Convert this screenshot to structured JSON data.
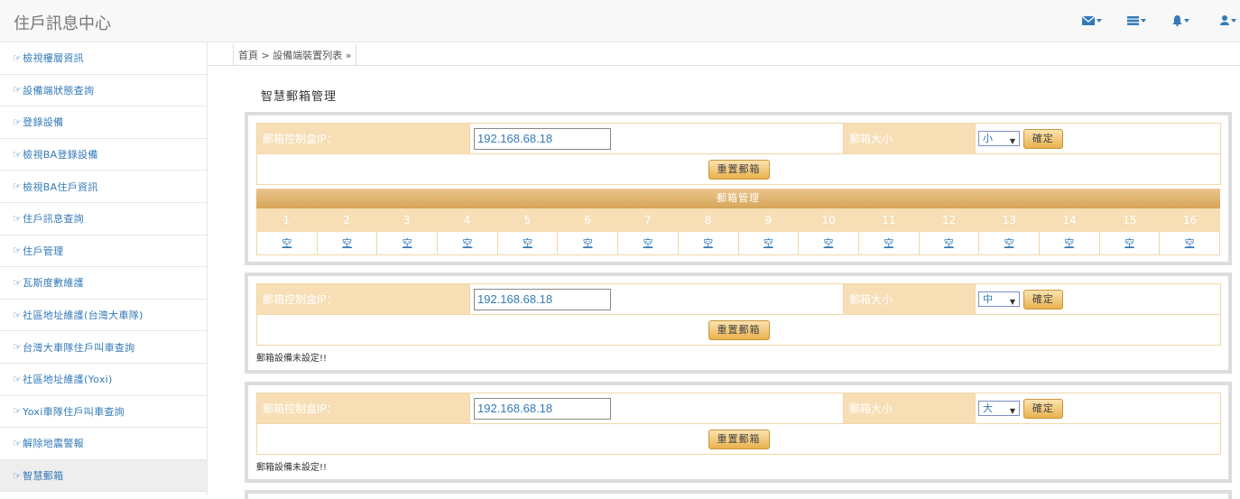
{
  "app": {
    "title": "住戶訊息中心"
  },
  "sidebar": {
    "items": [
      {
        "label": "檢視樓層資訊"
      },
      {
        "label": "設備端狀態查詢"
      },
      {
        "label": "登錄設備"
      },
      {
        "label": "檢視BA登錄設備"
      },
      {
        "label": "檢視BA住戶資訊"
      },
      {
        "label": "住戶訊息查詢"
      },
      {
        "label": "住戶管理"
      },
      {
        "label": "瓦斯度數維護"
      },
      {
        "label": "社區地址維護(台灣大車隊)"
      },
      {
        "label": "台灣大車隊住戶叫車查詢"
      },
      {
        "label": "社區地址維護(Yoxi)"
      },
      {
        "label": "Yoxi車隊住戶叫車查詢"
      },
      {
        "label": "解除地震警報"
      },
      {
        "label": "智慧郵箱"
      }
    ],
    "hand_glyph": "☞"
  },
  "breadcrumb": {
    "text": "首頁 > 設備端裝置列表 »"
  },
  "page_title": "智慧郵箱管理",
  "panels": [
    {
      "ip_label": "郵箱控制盒IP：",
      "ip_value": "192.168.68.18",
      "size_label": "郵箱大小",
      "size_value": "小",
      "confirm_label": "確定",
      "reset_label": "重置郵箱",
      "mgmt_title": "郵箱管理",
      "slot_numbers": [
        "1",
        "2",
        "3",
        "4",
        "5",
        "6",
        "7",
        "8",
        "9",
        "10",
        "11",
        "12",
        "13",
        "14",
        "15",
        "16"
      ],
      "slot_status": "空"
    },
    {
      "ip_label": "郵箱控制盒IP：",
      "ip_value": "192.168.68.18",
      "size_label": "郵箱大小",
      "size_value": "中",
      "confirm_label": "確定",
      "reset_label": "重置郵箱",
      "note": "郵箱設備未設定!!"
    },
    {
      "ip_label": "郵箱控制盒IP：",
      "ip_value": "192.168.68.18",
      "size_label": "郵箱大小",
      "size_value": "大",
      "confirm_label": "確定",
      "reset_label": "重置郵箱",
      "note": "郵箱設備未設定!!"
    }
  ],
  "colors": {
    "accent": "#337ab7",
    "header_tan": "#f7deb5",
    "border": "#dddddd"
  },
  "icons": [
    "envelope-icon",
    "tasks-icon",
    "bell-icon",
    "user-icon"
  ]
}
